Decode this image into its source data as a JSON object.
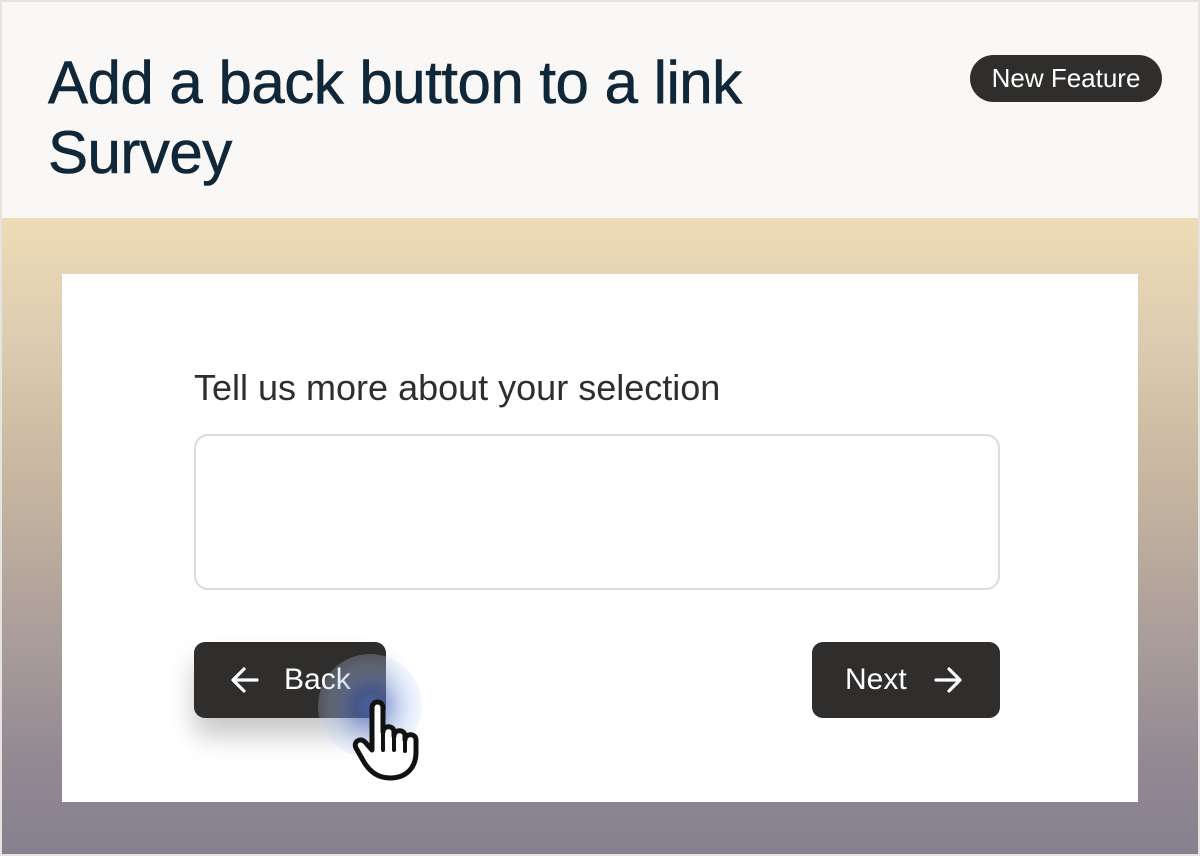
{
  "header": {
    "title": "Add a back button to a link Survey",
    "badge": "New Feature"
  },
  "survey": {
    "question": "Tell us more about your selection",
    "answer_value": "",
    "back_label": "Back",
    "next_label": "Next"
  },
  "icons": {
    "back": "arrow-left-icon",
    "next": "arrow-right-icon",
    "cursor": "hand-pointer-icon"
  },
  "colors": {
    "title": "#0f2738",
    "button_bg": "#2f2e2c",
    "button_text": "#ffffff",
    "badge_bg": "#2f2e2c",
    "gradient_top": "#eedcb6",
    "gradient_bottom": "#86808f",
    "click_ripple": "#5a78d2"
  }
}
